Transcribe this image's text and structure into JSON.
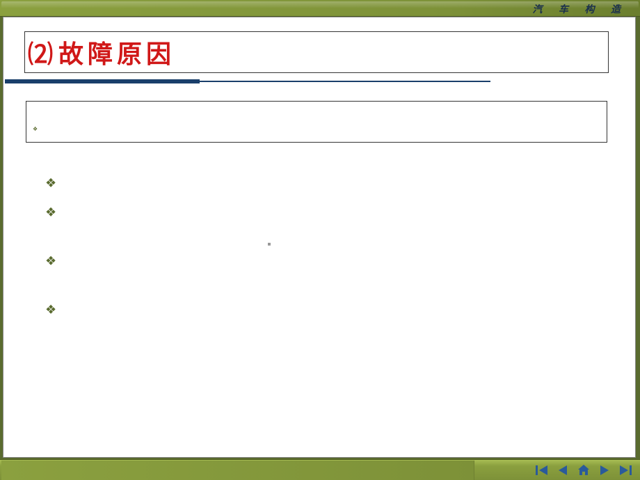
{
  "header": {
    "brand_text": "汽 车 构 造"
  },
  "title": {
    "number": "⑵",
    "text": "故障原因"
  },
  "bullets": {
    "items": [
      {
        "marker": "❖",
        "text": ""
      },
      {
        "marker": "❖",
        "text": ""
      },
      {
        "marker": "❖",
        "text": ""
      },
      {
        "marker": "❖",
        "text": ""
      }
    ],
    "sub_marker": "❖"
  },
  "nav": {
    "first": "first",
    "prev": "previous",
    "home": "home",
    "next": "next",
    "last": "last"
  },
  "colors": {
    "accent": "#5a6b2f",
    "title_red": "#d01818",
    "underline_blue": "#1a3f6b",
    "nav_blue": "#2a5a9a"
  }
}
